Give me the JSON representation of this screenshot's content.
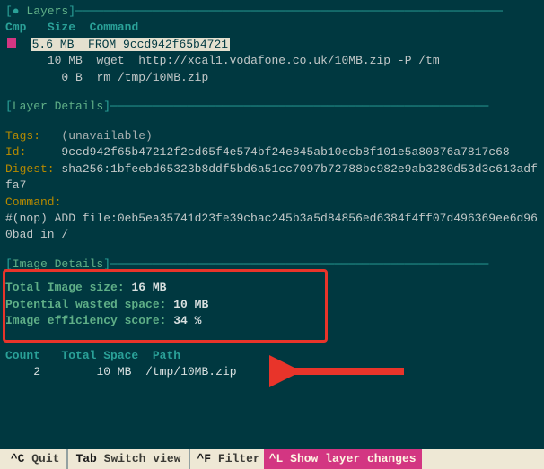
{
  "sections": {
    "layers_title": "Layers",
    "layer_details_title": "Layer Details",
    "image_details_title": "Image Details"
  },
  "layers": {
    "headers": {
      "cmp": "Cmp",
      "size": "Size",
      "command": "Command"
    },
    "rows": [
      {
        "size": "5.6 MB",
        "command": "FROM 9ccd942f65b4721",
        "selected": true
      },
      {
        "size": "10 MB",
        "command": "wget  http://xcal1.vodafone.co.uk/10MB.zip -P /tm",
        "selected": false
      },
      {
        "size": "0 B",
        "command": "rm /tmp/10MB.zip",
        "selected": false
      }
    ]
  },
  "layer_details": {
    "tags_label": "Tags:",
    "tags_value": "(unavailable)",
    "id_label": "Id:",
    "id_value": "9ccd942f65b47212f2cd65f4e574bf24e845ab10ecb8f101e5a80876a7817c68",
    "digest_label": "Digest:",
    "digest_value": "sha256:1bfeebd65323b8ddf5bd6a51cc7097b72788bc982e9ab3280d53d3c613adffa7",
    "command_label": "Command:",
    "command_value": "#(nop) ADD file:0eb5ea35741d23fe39cbac245b3a5d84856ed6384f4ff07d496369ee6d960bad in /"
  },
  "image_details": {
    "total_label": "Total Image size:",
    "total_value": "16 MB",
    "wasted_label": "Potential wasted space:",
    "wasted_value": "10 MB",
    "eff_label": "Image efficiency score:",
    "eff_value": "34 %"
  },
  "wasted_table": {
    "headers": {
      "count": "Count",
      "total": "Total Space",
      "path": "Path"
    },
    "rows": [
      {
        "count": "2",
        "total": "10 MB",
        "path": "/tmp/10MB.zip"
      }
    ]
  },
  "statusbar": {
    "quit_key": "^C",
    "quit_label": "Quit",
    "tab_key": "Tab",
    "tab_label": "Switch view",
    "filter_key": "^F",
    "filter_label": "Filter",
    "changes_key": "^L",
    "changes_label": "Show layer changes"
  }
}
